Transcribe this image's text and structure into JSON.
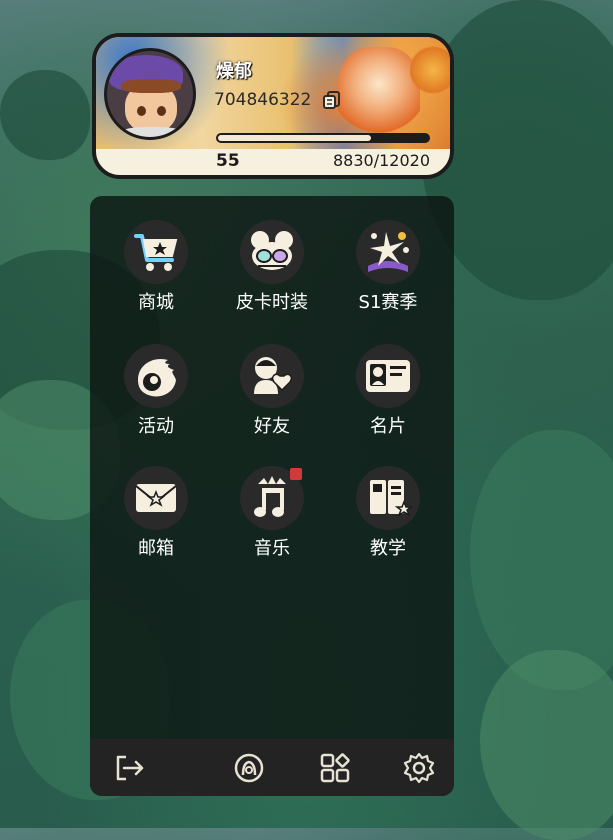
{
  "profile": {
    "username": "燥郁",
    "uid": "704846322",
    "level": "55",
    "xp_text": "8830/12020",
    "xp_progress": 0.735
  },
  "menu": {
    "items": [
      {
        "label": "商城",
        "icon": "shop-cart-icon"
      },
      {
        "label": "皮卡时装",
        "icon": "fashion-mask-icon"
      },
      {
        "label": "S1赛季",
        "icon": "season-star-icon"
      },
      {
        "label": "活动",
        "icon": "event-flame-icon"
      },
      {
        "label": "好友",
        "icon": "friends-heart-icon"
      },
      {
        "label": "名片",
        "icon": "name-card-icon"
      },
      {
        "label": "邮箱",
        "icon": "mail-icon"
      },
      {
        "label": "音乐",
        "icon": "music-icon"
      },
      {
        "label": "教学",
        "icon": "tutorial-book-icon"
      }
    ]
  },
  "bottom_bar": [
    "logout-icon",
    "support-icon",
    "apps-grid-icon",
    "settings-gear-icon"
  ],
  "colors": {
    "badge": "#d23a3a",
    "panel": "#0c1612",
    "circle": "#2a2a2a"
  }
}
